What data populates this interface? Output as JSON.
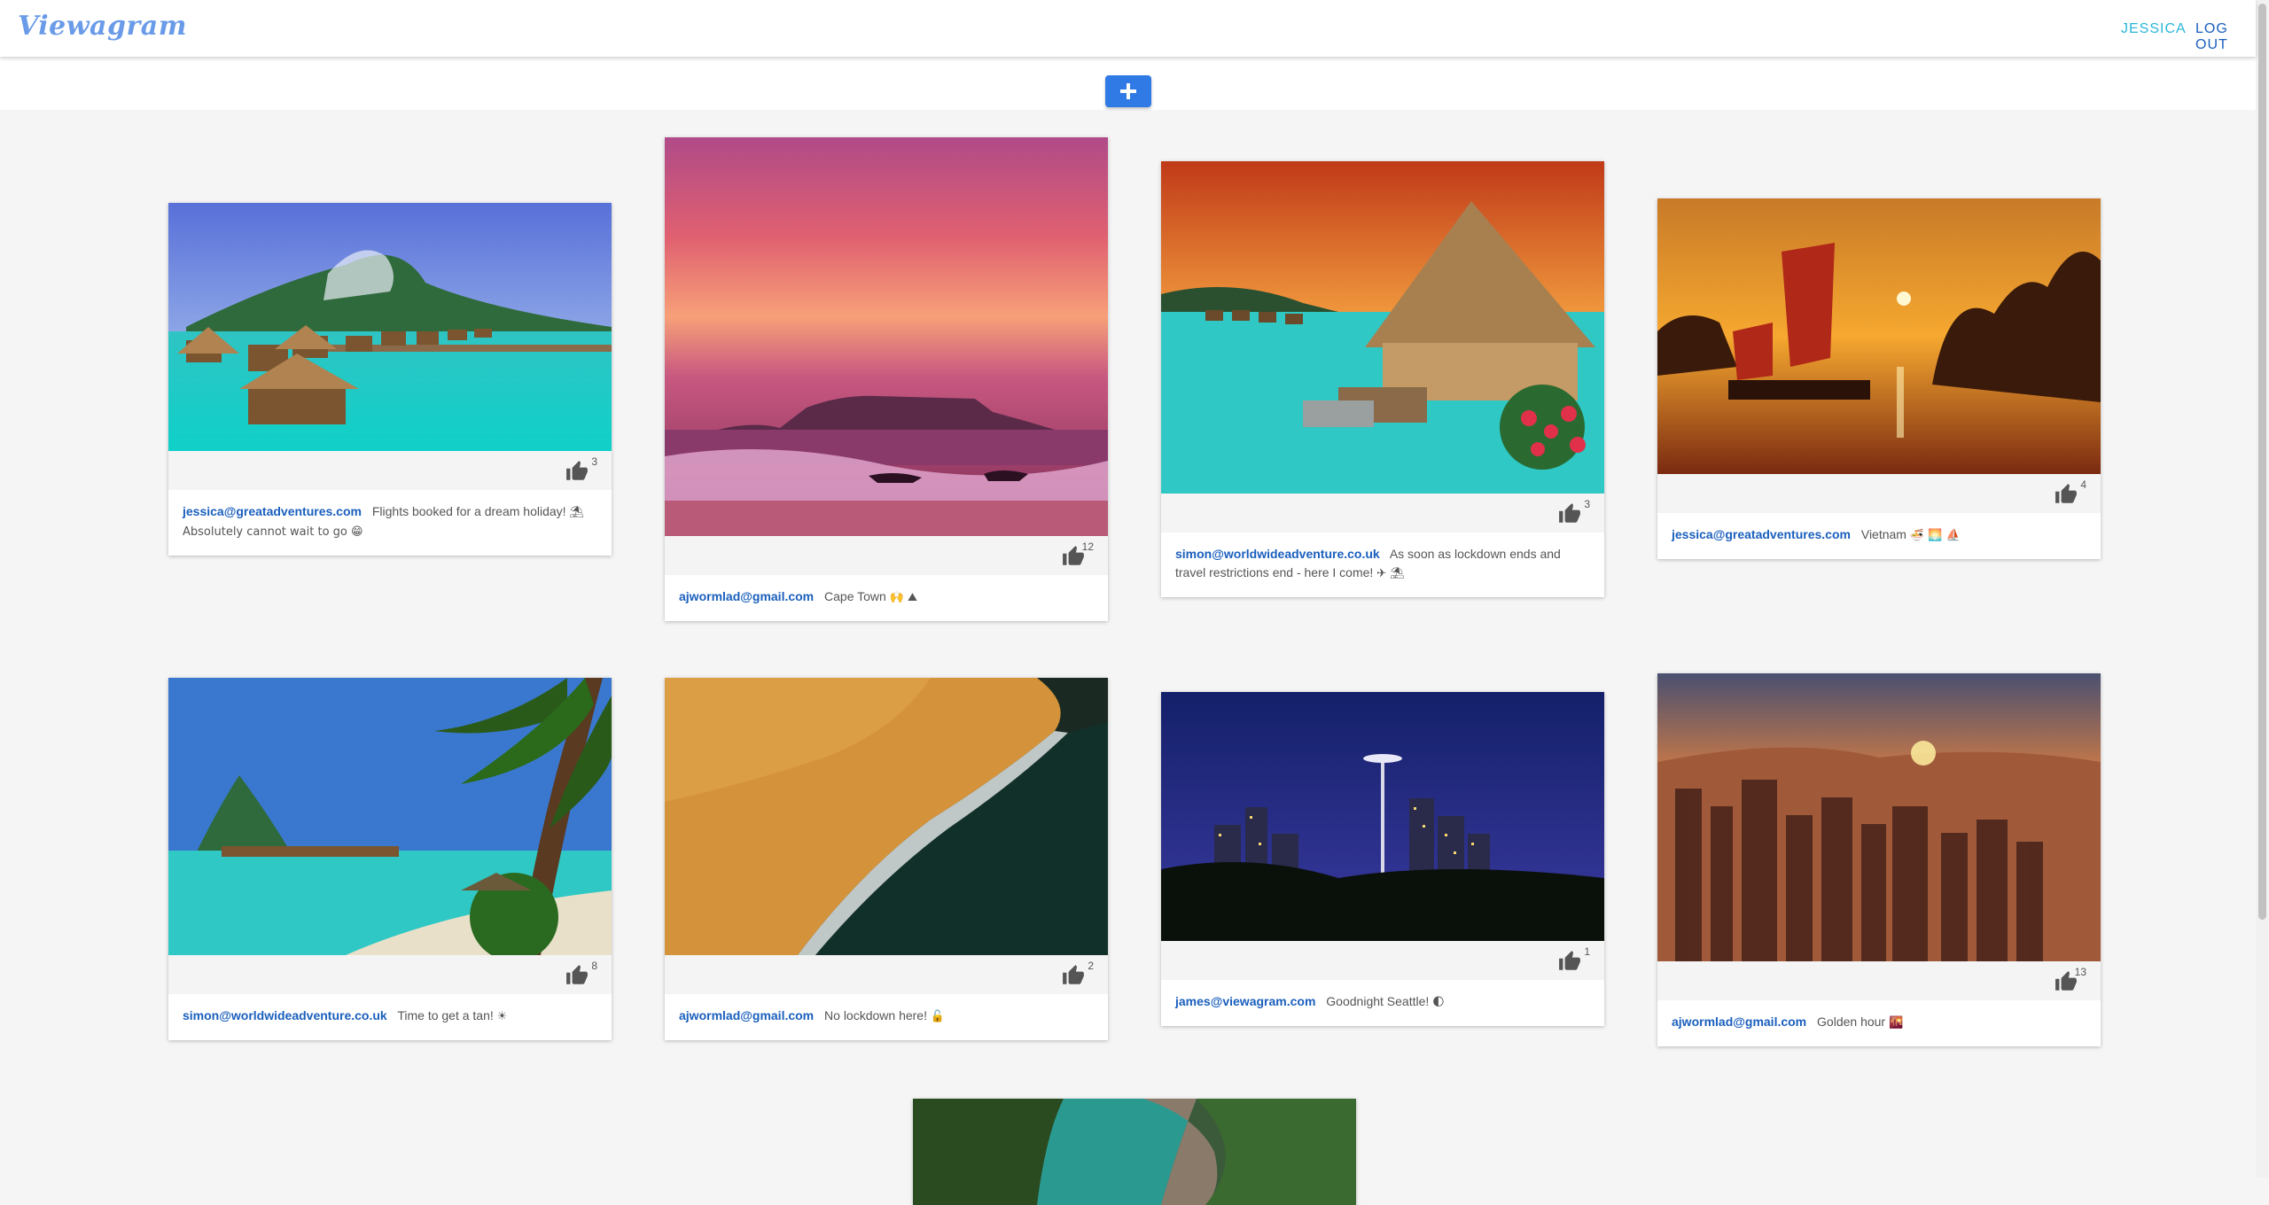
{
  "app": {
    "brand": "Viewagram"
  },
  "nav": {
    "user": "JESSICA",
    "logout": "LOG OUT"
  },
  "colors": {
    "primary": "#2f7ae5",
    "link": "#1a5fbd",
    "user_link": "#29b6d9",
    "brand": "#6a9be8"
  },
  "actions": {
    "add_icon": "plus-icon"
  },
  "posts": [
    {
      "author": "jessica@greatadventures.com",
      "text": "Flights booked for a dream holiday!",
      "emoji": "⛱ Absolutely cannot wait to go 😁",
      "likes": "3",
      "scene": "overwater-bungalows"
    },
    {
      "author": "ajwormlad@gmail.com",
      "text": "Cape Town",
      "emoji": "🙌 ⛰",
      "likes": "12",
      "scene": "pink-sunset-beach"
    },
    {
      "author": "simon@worldwideadventure.co.uk",
      "text": "As soon as lockdown ends and travel restrictions end - here I come!",
      "emoji": "✈ ⛱",
      "likes": "3",
      "scene": "thatched-hut-lagoon"
    },
    {
      "author": "jessica@greatadventures.com",
      "text": "Vietnam",
      "emoji": "🍜 🌅 ⛵",
      "likes": "4",
      "scene": "junk-boat-sunset"
    },
    {
      "author": "simon@worldwideadventure.co.uk",
      "text": "Time to get a tan!",
      "emoji": "☀",
      "likes": "8",
      "scene": "palm-beach"
    },
    {
      "author": "ajwormlad@gmail.com",
      "text": "No lockdown here!",
      "emoji": "🔓",
      "likes": "2",
      "scene": "desert-coast"
    },
    {
      "author": "james@viewagram.com",
      "text": "Goodnight Seattle!",
      "emoji": "🌓",
      "likes": "1",
      "scene": "night-skyline"
    },
    {
      "author": "ajwormlad@gmail.com",
      "text": "Golden hour",
      "emoji": "🌇",
      "likes": "13",
      "scene": "city-sunset"
    },
    {
      "author": "",
      "text": "",
      "emoji": "",
      "likes": "",
      "scene": "river-canyon"
    }
  ]
}
